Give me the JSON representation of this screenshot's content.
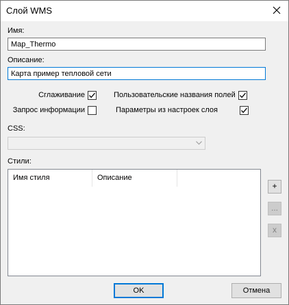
{
  "window": {
    "title": "Слой WMS"
  },
  "form": {
    "name_label": "Имя:",
    "name_value": "Map_Thermo",
    "description_label": "Описание:",
    "description_value": "Карта пример тепловой сети",
    "css_label": "CSS:",
    "css_value": "",
    "styles_label": "Стили:"
  },
  "options": {
    "smoothing": {
      "label": "Сглаживание",
      "checked": true
    },
    "user_field_names": {
      "label": "Пользовательские названия полей",
      "checked": true
    },
    "query_info": {
      "label": "Запрос информации",
      "checked": false
    },
    "layer_settings_params": {
      "label": "Параметры из настроек слоя",
      "checked": true
    }
  },
  "styles_table": {
    "columns": [
      "Имя стиля",
      "Описание"
    ],
    "rows": []
  },
  "side_buttons": {
    "add": "+",
    "edit": "...",
    "remove": "x"
  },
  "buttons": {
    "ok": "OK",
    "cancel": "Отмена"
  },
  "colors": {
    "focus_border": "#0078d7",
    "dialog_bg": "#f0f0f0"
  }
}
